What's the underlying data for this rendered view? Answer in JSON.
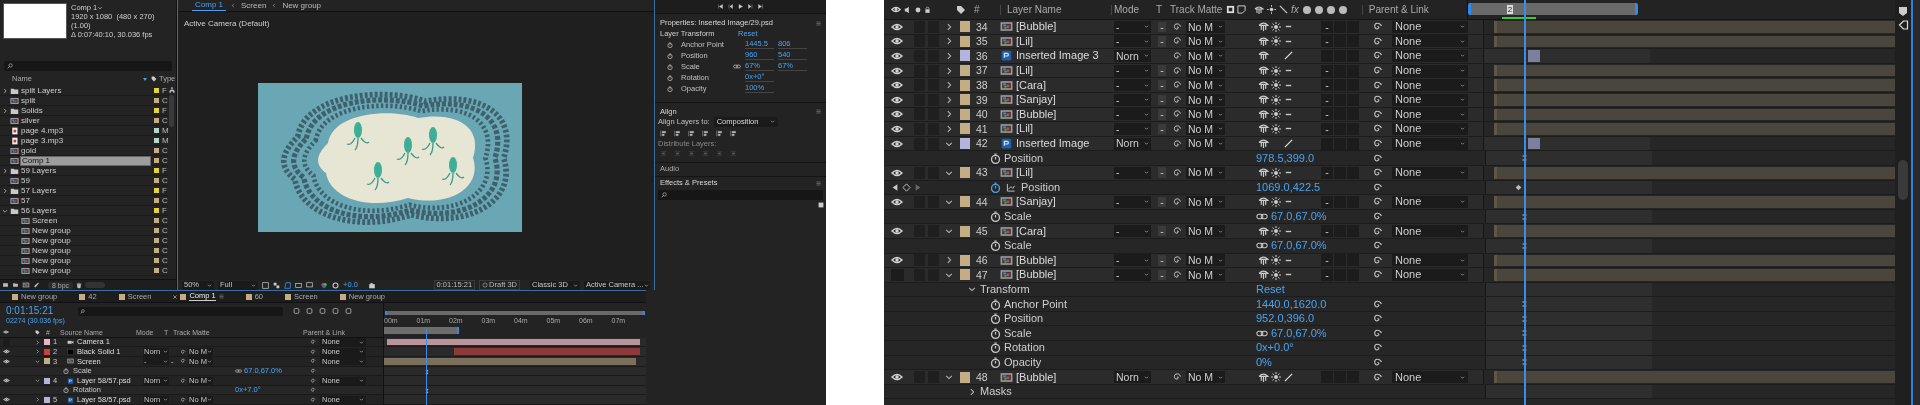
{
  "left": {
    "project": {
      "comp_title": "Comp 1",
      "comp_size": "1920 x 1080  (480 x 270) (1.00)",
      "comp_info": "Δ 0:07:40:10, 30.036 fps",
      "columns": [
        "Name",
        "Type"
      ],
      "bpc": "8 bpc",
      "items": [
        {
          "name": "spilt Layers",
          "kind": "folder",
          "expanded": false,
          "selected": false,
          "color": "#e6d23a",
          "type": "F"
        },
        {
          "name": "spilt",
          "kind": "comp",
          "selected": false,
          "color": "#c4ad85",
          "type": "C"
        },
        {
          "name": "Solids",
          "kind": "folder",
          "expanded": false,
          "selected": false,
          "color": "#e6d23a",
          "type": "F"
        },
        {
          "name": "silver",
          "kind": "comp",
          "selected": false,
          "color": "#c4ad85",
          "type": "C"
        },
        {
          "name": "page 4.mp3",
          "kind": "audio",
          "selected": false,
          "color": "#b5d6c6",
          "type": "M"
        },
        {
          "name": "page 3.mp3",
          "kind": "audio",
          "selected": false,
          "color": "#b5d6c6",
          "type": "M"
        },
        {
          "name": "gold",
          "kind": "comp",
          "selected": false,
          "color": "#c4ad85",
          "type": "C"
        },
        {
          "name": "Comp 1",
          "kind": "comp",
          "selected": true,
          "color": "#c4ad85",
          "type": "C"
        },
        {
          "name": "59 Layers",
          "kind": "folder",
          "expanded": false,
          "selected": false,
          "color": "#e6d23a",
          "type": "F"
        },
        {
          "name": "59",
          "kind": "comp",
          "selected": false,
          "color": "#c4ad85",
          "type": "C"
        },
        {
          "name": "57 Layers",
          "kind": "folder",
          "expanded": false,
          "selected": false,
          "color": "#e6d23a",
          "type": "F"
        },
        {
          "name": "57",
          "kind": "comp",
          "selected": false,
          "color": "#c4ad85",
          "type": "C"
        },
        {
          "name": "56 Layers",
          "kind": "folder",
          "expanded": true,
          "selected": false,
          "color": "#e6d23a",
          "type": "F",
          "children": [
            {
              "name": "Screen",
              "kind": "comp",
              "selected": false,
              "color": "#c4ad85",
              "type": "C"
            },
            {
              "name": "New group",
              "kind": "comp",
              "selected": false,
              "color": "#c4ad85",
              "type": "C"
            },
            {
              "name": "New group",
              "kind": "comp",
              "selected": false,
              "color": "#c4ad85",
              "type": "C"
            },
            {
              "name": "New group",
              "kind": "comp",
              "selected": false,
              "color": "#c4ad85",
              "type": "C"
            },
            {
              "name": "New group",
              "kind": "comp",
              "selected": false,
              "color": "#c4ad85",
              "type": "C"
            },
            {
              "name": "New group",
              "kind": "comp",
              "selected": false,
              "color": "#c4ad85",
              "type": "C"
            }
          ]
        }
      ]
    },
    "viewer": {
      "breadcrumbs": [
        {
          "label": "Comp 1",
          "selected": true
        },
        {
          "label": "Screen",
          "selected": false
        },
        {
          "label": "New group",
          "selected": false
        }
      ],
      "camera_label": "Active Camera (Default)",
      "toolbar": {
        "magnification": "50%",
        "resolution": "Full",
        "exposure": "+0.0",
        "timecode": "0:01:15:21",
        "draft": "Draft 3D",
        "renderer": "Classic 3D",
        "view": "Active Camera ..."
      }
    },
    "properties": {
      "title": "Properties: Inserted Image/29.psd",
      "section": "Layer Transform",
      "reset": "Reset",
      "rows": [
        {
          "label": "Anchor Point",
          "values": [
            "1445.5",
            "806"
          ],
          "linked": false
        },
        {
          "label": "Position",
          "values": [
            "960",
            "540"
          ],
          "linked": false
        },
        {
          "label": "Scale",
          "values": [
            "67%",
            "67%"
          ],
          "linked": true
        },
        {
          "label": "Rotation",
          "values": [
            "0x+0°"
          ],
          "linked": false
        },
        {
          "label": "Opacity",
          "values": [
            "100%"
          ],
          "linked": false
        }
      ],
      "align_title": "Align",
      "align_to_label": "Align Layers to:",
      "align_to": "Composition",
      "distribute_label": "Distribute Layers:",
      "audio": "Audio",
      "effects": "Effects & Presets"
    },
    "timeline": {
      "tabs": [
        {
          "label": "New group",
          "selected": false
        },
        {
          "label": "42",
          "selected": false
        },
        {
          "label": "Screen",
          "selected": false
        },
        {
          "label": "Comp 1",
          "selected": true
        },
        {
          "label": "60",
          "selected": false
        },
        {
          "label": "Screen",
          "selected": false
        },
        {
          "label": "New group",
          "selected": false
        }
      ],
      "timecode": "0:01:15:21",
      "frame_info": "02274 (30.036 fps)",
      "columns": {
        "number": "#",
        "name": "Source Name",
        "mode": "Mode",
        "t": "T",
        "matte": "Track Matte",
        "parent": "Parent & Link"
      },
      "ruler": [
        "00m",
        "01m",
        "02m",
        "03m",
        "04m",
        "05m",
        "06m",
        "07m"
      ],
      "rows": [
        {
          "kind": "camera",
          "number": "1",
          "name": "Camera 1",
          "color": "#e9b7c4",
          "visible": false,
          "expanded": false,
          "parent": "None"
        },
        {
          "kind": "solid",
          "number": "2",
          "name": "Black Solid 1",
          "color": "#c94040",
          "visible": true,
          "expanded": false,
          "mode": "Norn",
          "matte": "No M",
          "parent": "None"
        },
        {
          "kind": "comp",
          "number": "3",
          "name": "Screen",
          "color": "#c4ad85",
          "visible": true,
          "expanded": true,
          "mode": "-",
          "preserve": "-",
          "matte": "No M",
          "parent": "None",
          "children": [
            {
              "kind": "property",
              "name": "Scale",
              "value": "67.0,67.0%",
              "linked": true
            }
          ]
        },
        {
          "kind": "psd",
          "number": "4",
          "name": "Layer 58/57.psd",
          "color": "#b4b4dc",
          "visible": true,
          "expanded": true,
          "mode": "Norn",
          "matte": "No M",
          "parent": "None",
          "children": [
            {
              "kind": "property",
              "name": "Rotation",
              "value": "0x+7.0°",
              "linked": false
            }
          ]
        },
        {
          "kind": "psd",
          "number": "5",
          "name": "Layer 58/57.psd",
          "color": "#b4b4dc",
          "visible": true,
          "expanded": false,
          "mode": "Norn",
          "matte": "No M",
          "parent": "None"
        }
      ]
    }
  },
  "right": {
    "columns": {
      "number": "#",
      "name": "Layer Name",
      "mode": "Mode",
      "t": "T",
      "matte": "Track Matte",
      "fx": "fx",
      "parent": "Parent & Link"
    },
    "marker_label": "2",
    "rows": [
      {
        "kind": "comp",
        "number": "34",
        "name": "[Bubble]",
        "color": "#c4ad85",
        "visible": true,
        "expanded": false,
        "mode": "-",
        "preserve": "-",
        "matte": "No M",
        "best_quality": false,
        "collapse": true,
        "blur": "-",
        "parent": "None"
      },
      {
        "kind": "comp",
        "number": "35",
        "name": "[Lil]",
        "color": "#c4ad85",
        "visible": true,
        "expanded": false,
        "mode": "-",
        "preserve": "-",
        "matte": "No M",
        "best_quality": false,
        "collapse": true,
        "blur": "-",
        "parent": "None"
      },
      {
        "kind": "psd",
        "number": "36",
        "name": "Inserted Image 3",
        "color": "#b4b4dc",
        "visible": true,
        "expanded": false,
        "mode": "Norn",
        "matte": "No M",
        "best_quality": true,
        "collapse": false,
        "parent": "None"
      },
      {
        "kind": "comp",
        "number": "37",
        "name": "[Lil]",
        "color": "#c4ad85",
        "visible": true,
        "expanded": false,
        "mode": "-",
        "preserve": "-",
        "matte": "No M",
        "best_quality": false,
        "collapse": true,
        "blur": "-",
        "parent": "None"
      },
      {
        "kind": "comp",
        "number": "38",
        "name": "[Cara]",
        "color": "#c4ad85",
        "visible": true,
        "expanded": false,
        "mode": "-",
        "preserve": "-",
        "matte": "No M",
        "best_quality": false,
        "collapse": true,
        "blur": "-",
        "parent": "None"
      },
      {
        "kind": "comp",
        "number": "39",
        "name": "[Sanjay]",
        "color": "#c4ad85",
        "visible": true,
        "expanded": false,
        "mode": "-",
        "preserve": "-",
        "matte": "No M",
        "best_quality": false,
        "collapse": true,
        "blur": "-",
        "parent": "None"
      },
      {
        "kind": "comp",
        "number": "40",
        "name": "[Bubble]",
        "color": "#c4ad85",
        "visible": true,
        "expanded": false,
        "mode": "-",
        "preserve": "-",
        "matte": "No M",
        "best_quality": false,
        "collapse": true,
        "blur": "-",
        "parent": "None"
      },
      {
        "kind": "comp",
        "number": "41",
        "name": "[Lil]",
        "color": "#c4ad85",
        "visible": true,
        "expanded": false,
        "mode": "-",
        "preserve": "-",
        "matte": "No M",
        "best_quality": false,
        "collapse": true,
        "blur": "-",
        "parent": "None"
      },
      {
        "kind": "psd",
        "number": "42",
        "name": "Inserted Image",
        "color": "#b4b4dc",
        "visible": true,
        "expanded": true,
        "mode": "Norn",
        "matte": "No M",
        "best_quality": true,
        "collapse": false,
        "parent": "None",
        "children": [
          {
            "kind": "property",
            "name": "Position",
            "value": "978.5,399.0",
            "linked": false,
            "animated": false
          }
        ]
      },
      {
        "kind": "comp",
        "number": "43",
        "name": "[Lil]",
        "color": "#c4ad85",
        "visible": true,
        "expanded": true,
        "mode": "-",
        "preserve": "-",
        "matte": "No M",
        "best_quality": false,
        "collapse": true,
        "blur": "-",
        "parent": "None",
        "children": [
          {
            "kind": "property",
            "name": "Position",
            "value": "1069.0,422.5",
            "linked": false,
            "animated": true
          }
        ]
      },
      {
        "kind": "comp",
        "number": "44",
        "name": "[Sanjay]",
        "color": "#c4ad85",
        "visible": true,
        "expanded": true,
        "mode": "-",
        "preserve": "-",
        "matte": "No M",
        "best_quality": false,
        "collapse": true,
        "blur": "-",
        "parent": "None",
        "children": [
          {
            "kind": "property",
            "name": "Scale",
            "value": "67.0,67.0%",
            "linked": true,
            "animated": false
          }
        ]
      },
      {
        "kind": "comp",
        "number": "45",
        "name": "[Cara]",
        "color": "#c4ad85",
        "visible": true,
        "expanded": true,
        "mode": "-",
        "preserve": "-",
        "matte": "No M",
        "best_quality": false,
        "collapse": true,
        "blur": "-",
        "parent": "None",
        "children": [
          {
            "kind": "property",
            "name": "Scale",
            "value": "67.0,67.0%",
            "linked": true,
            "animated": false
          }
        ]
      },
      {
        "kind": "comp",
        "number": "46",
        "name": "[Bubble]",
        "color": "#c4ad85",
        "visible": true,
        "expanded": false,
        "mode": "-",
        "preserve": "-",
        "matte": "No M",
        "best_quality": false,
        "collapse": true,
        "blur": "-",
        "parent": "None"
      },
      {
        "kind": "comp",
        "number": "47",
        "name": "[Bubble]",
        "color": "#c4ad85",
        "visible": false,
        "expanded": true,
        "mode": "-",
        "preserve": "-",
        "matte": "No M",
        "best_quality": false,
        "collapse": true,
        "blur": "-",
        "parent": "None",
        "children": [
          {
            "kind": "group",
            "name": "Transform",
            "expanded": true,
            "value": "Reset",
            "children": [
              {
                "kind": "property",
                "name": "Anchor Point",
                "value": "1440.0,1620.0",
                "linked": false,
                "animated": false
              },
              {
                "kind": "property",
                "name": "Position",
                "value": "952.0,396.0",
                "linked": false,
                "animated": false
              },
              {
                "kind": "property",
                "name": "Scale",
                "value": "67.0,67.0%",
                "linked": true,
                "animated": false
              },
              {
                "kind": "property",
                "name": "Rotation",
                "value": "0x+0.0°",
                "linked": false,
                "animated": false
              },
              {
                "kind": "property",
                "name": "Opacity",
                "value": "0%",
                "linked": false,
                "animated": false
              }
            ]
          }
        ]
      },
      {
        "kind": "comp",
        "number": "48",
        "name": "[Bubble]",
        "color": "#c4ad85",
        "visible": true,
        "expanded": true,
        "mode": "Norn",
        "matte": "No M",
        "best_quality": true,
        "collapse": true,
        "parent": "None",
        "children": [
          {
            "kind": "group",
            "name": "Masks",
            "expanded": false
          }
        ]
      }
    ]
  }
}
